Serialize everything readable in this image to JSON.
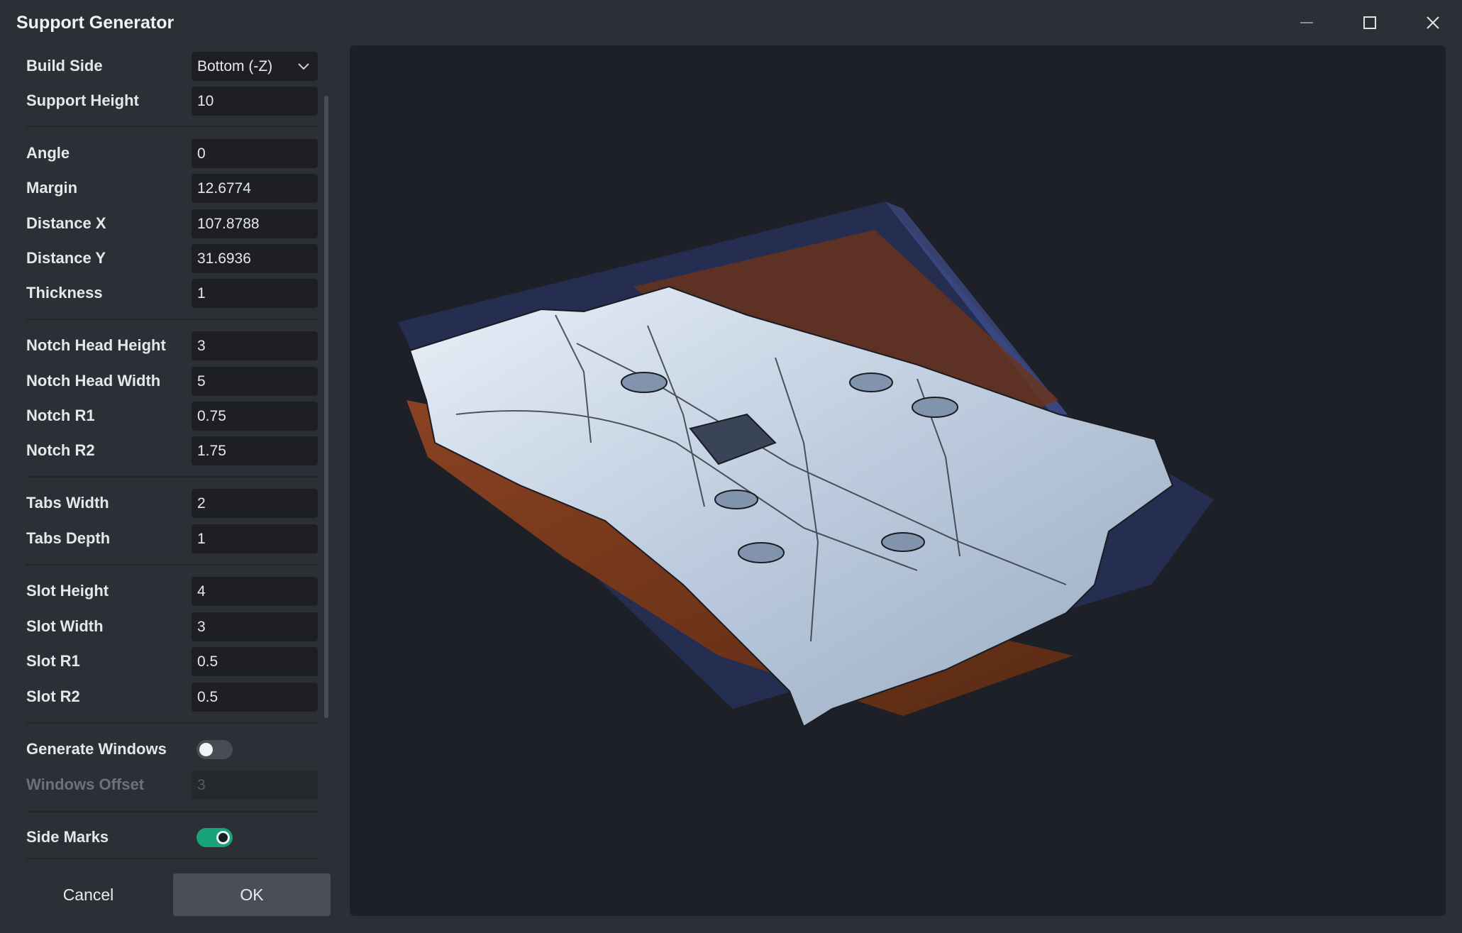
{
  "window": {
    "title": "Support Generator",
    "controls": [
      "minimize-icon",
      "maximize-icon",
      "close-icon"
    ]
  },
  "form": {
    "build_side": {
      "label": "Build Side",
      "value": "Bottom (-Z)"
    },
    "support_height": {
      "label": "Support Height",
      "value": "10"
    },
    "angle": {
      "label": "Angle",
      "value": "0"
    },
    "margin": {
      "label": "Margin",
      "value": "12.6774"
    },
    "distance_x": {
      "label": "Distance X",
      "value": "107.8788"
    },
    "distance_y": {
      "label": "Distance Y",
      "value": "31.6936"
    },
    "thickness": {
      "label": "Thickness",
      "value": "1"
    },
    "notch_head_height": {
      "label": "Notch Head Height",
      "value": "3"
    },
    "notch_head_width": {
      "label": "Notch Head Width",
      "value": "5"
    },
    "notch_r1": {
      "label": "Notch R1",
      "value": "0.75"
    },
    "notch_r2": {
      "label": "Notch R2",
      "value": "1.75"
    },
    "tabs_width": {
      "label": "Tabs Width",
      "value": "2"
    },
    "tabs_depth": {
      "label": "Tabs Depth",
      "value": "1"
    },
    "slot_height": {
      "label": "Slot Height",
      "value": "4"
    },
    "slot_width": {
      "label": "Slot Width",
      "value": "3"
    },
    "slot_r1": {
      "label": "Slot R1",
      "value": "0.5"
    },
    "slot_r2": {
      "label": "Slot R2",
      "value": "0.5"
    },
    "generate_windows": {
      "label": "Generate Windows",
      "checked": false
    },
    "windows_offset": {
      "label": "Windows Offset",
      "value": "3",
      "disabled": true
    },
    "side_marks": {
      "label": "Side Marks",
      "checked": true
    }
  },
  "buttons": {
    "cancel": "Cancel",
    "ok": "OK"
  },
  "colors": {
    "accent_toggle_on": "#19a37b",
    "viewport_bg": "#1e2027",
    "part_surface": "#c9d6e6",
    "support_fill": "#7a3a1c",
    "bounding_volume": "#3a4a8c"
  }
}
